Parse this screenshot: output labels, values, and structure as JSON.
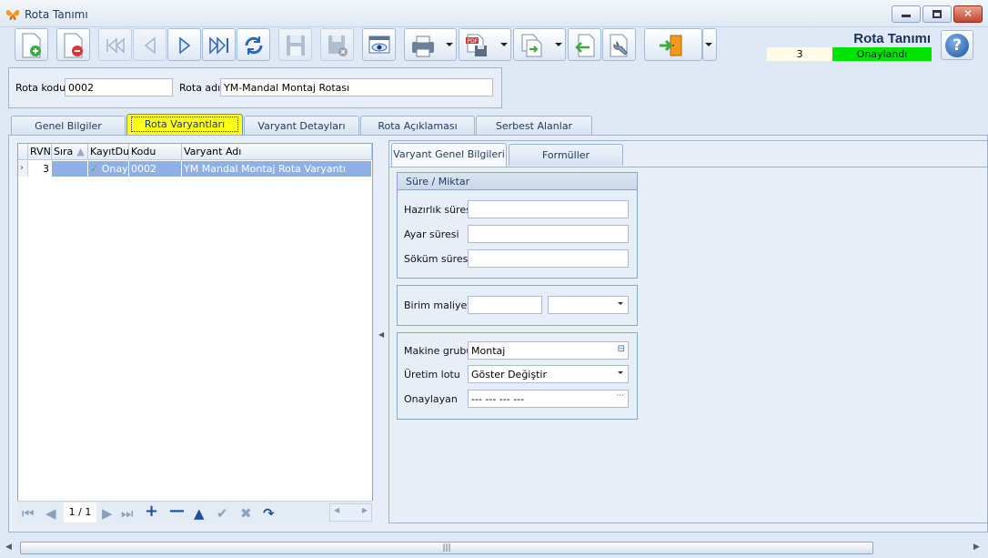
{
  "window": {
    "title": "Rota Tanımı"
  },
  "toolbar": {
    "module_title": "Rota Tanımı",
    "record_number": "3",
    "status": "Onaylandı",
    "help_label": "?"
  },
  "header": {
    "rota_kodu_label": "Rota kodu",
    "rota_kodu_value": "0002",
    "rota_adi_label": "Rota adı",
    "rota_adi_value": "YM-Mandal Montaj Rotası"
  },
  "tabs": [
    "Genel Bilgiler",
    "Rota Varyantları",
    "Varyant Detayları",
    "Rota Açıklaması",
    "Serbest Alanlar"
  ],
  "grid": {
    "columns": [
      "RVNo",
      "Sıra",
      "KayıtDurumu",
      "Kodu",
      "Varyant Adı"
    ],
    "rows": [
      {
        "rvno": "3",
        "sira": "",
        "kayit": "Onaylandı",
        "kodu": "0002",
        "varyant_adi": "YM Mandal Montaj Rota Varyantı"
      }
    ],
    "pager": "1 / 1"
  },
  "detail_tabs": [
    "Varyant Genel Bilgileri",
    "Formüller"
  ],
  "sure_miktar": {
    "title": "Süre / Miktar",
    "hazirlik_label": "Hazırlık süresi",
    "ayar_label": "Ayar süresi",
    "sokum_label": "Söküm süresi"
  },
  "maliyet": {
    "label": "Birim maliyet"
  },
  "uretim": {
    "makine_label": "Makine grubu",
    "makine_value": "Montaj",
    "lot_label": "Üretim lotu",
    "lot_value": "Göster Değiştir",
    "onaylayan_label": "Onaylayan",
    "onaylayan_value": "--- --- --- ---"
  },
  "colors": {
    "accent_tab": "#ffff1a",
    "status_badge": "#00e400",
    "selection": "#8fb0e6"
  }
}
